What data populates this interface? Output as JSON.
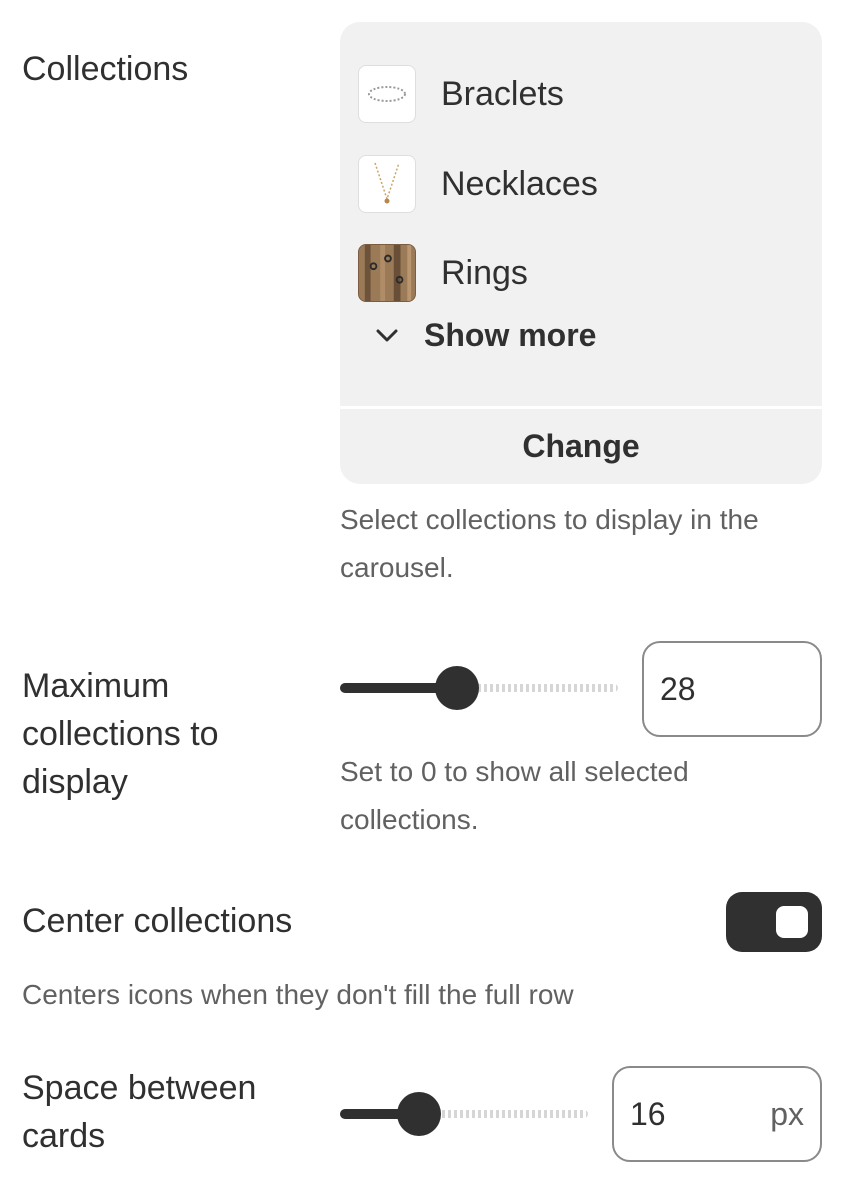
{
  "collections": {
    "label": "Collections",
    "items": [
      {
        "name": "Braclets",
        "icon": "bracelet-thumbnail"
      },
      {
        "name": "Necklaces",
        "icon": "necklace-thumbnail"
      },
      {
        "name": "Rings",
        "icon": "rings-thumbnail"
      }
    ],
    "show_more_label": "Show more",
    "change_label": "Change",
    "help": "Select collections to display in the carousel."
  },
  "max_collections": {
    "label": "Maximum collections to display",
    "value": "28",
    "slider_fraction": 0.42,
    "help": "Set to 0 to show all selected collections."
  },
  "center_collections": {
    "label": "Center collections",
    "enabled": true,
    "help": "Centers icons when they don't fill the full row"
  },
  "space_between_cards": {
    "label": "Space between cards",
    "value": "16",
    "unit": "px",
    "slider_fraction": 0.32
  },
  "colors": {
    "text": "#303030",
    "help_text": "#616161",
    "card_background": "#f1f1f1",
    "control_dark": "#303030"
  }
}
